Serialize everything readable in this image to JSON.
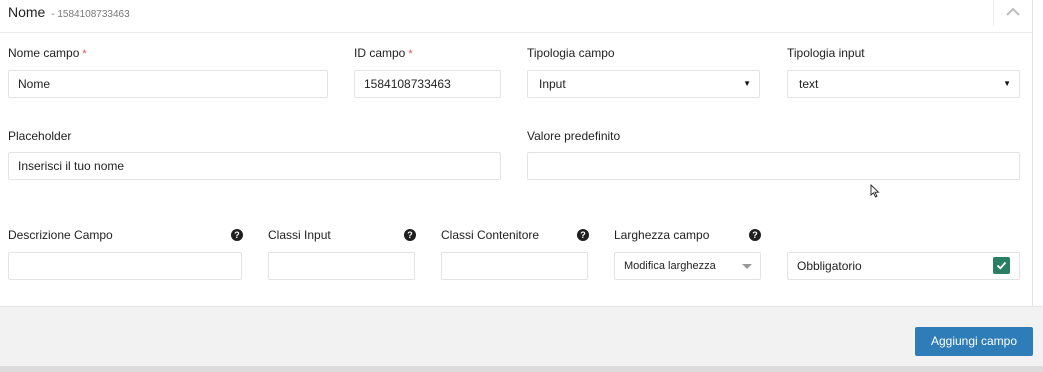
{
  "header": {
    "title": "Nome",
    "id_text": "- 1584108733463"
  },
  "fields": {
    "nome_campo": {
      "label": "Nome campo",
      "required_mark": "*",
      "value": "Nome"
    },
    "id_campo": {
      "label": "ID campo",
      "required_mark": "*",
      "value": "1584108733463"
    },
    "tipologia_campo": {
      "label": "Tipologia campo",
      "value": "Input"
    },
    "tipologia_input": {
      "label": "Tipologia input",
      "value": "text"
    },
    "placeholder": {
      "label": "Placeholder",
      "value": "Inserisci il tuo nome"
    },
    "valore_predefinito": {
      "label": "Valore predefinito",
      "value": ""
    },
    "descrizione_campo": {
      "label": "Descrizione Campo",
      "value": ""
    },
    "classi_input": {
      "label": "Classi Input",
      "value": ""
    },
    "classi_contenitore": {
      "label": "Classi Contenitore",
      "value": ""
    },
    "larghezza_campo": {
      "label": "Larghezza campo",
      "value": "Modifica larghezza"
    },
    "obbligatorio": {
      "label": "Obbligatorio",
      "checked": true
    }
  },
  "footer": {
    "add_button_label": "Aggiungi campo"
  },
  "icons": {
    "help": "question-circle-icon",
    "collapse": "chevron-up-icon",
    "check": "check-icon",
    "select_caret": "caret-down-icon"
  },
  "colors": {
    "required": "#e2504b",
    "check": "#2a7e62",
    "primary_button": "#2e7db8"
  }
}
